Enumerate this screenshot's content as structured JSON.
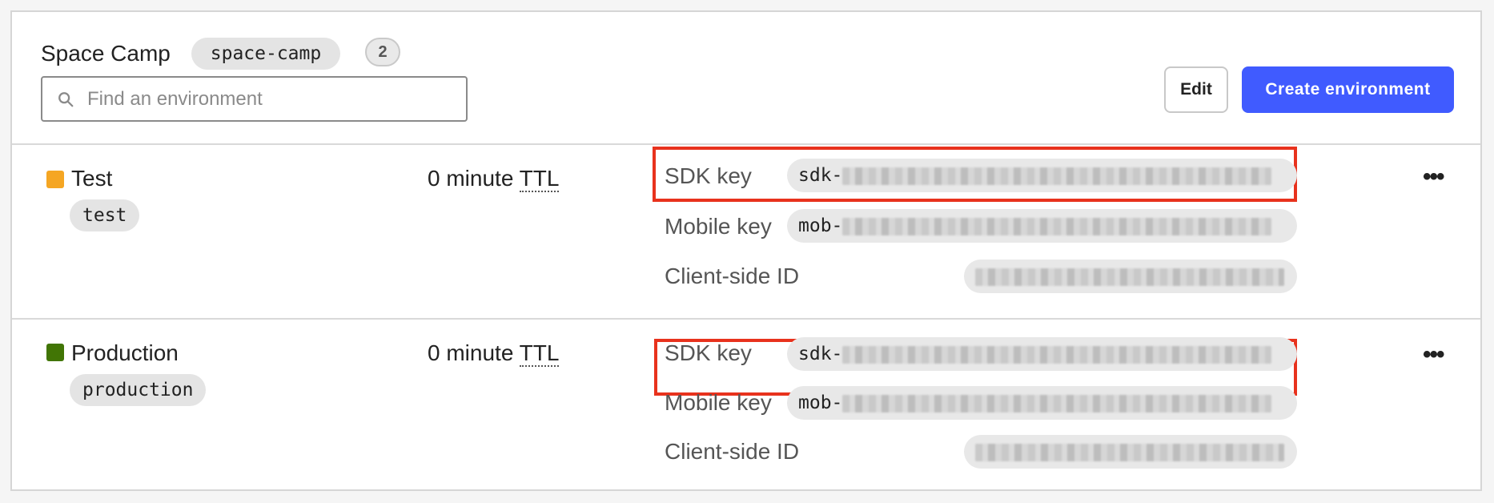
{
  "project": {
    "name": "Space Camp",
    "key": "space-camp",
    "environment_count": "2"
  },
  "search": {
    "placeholder": "Find an environment",
    "value": ""
  },
  "actions": {
    "edit_label": "Edit",
    "create_label": "Create environment"
  },
  "colors": {
    "accent": "#405bff",
    "highlight": "#e8321d",
    "test_env": "#f5a623",
    "production_env": "#417505"
  },
  "environments": [
    {
      "name": "Test",
      "key": "test",
      "ttl_value": "0 minute ",
      "ttl_abbr": "TTL",
      "sdk_label": "SDK key",
      "sdk_prefix": "sdk-",
      "mobile_label": "Mobile key",
      "mobile_prefix": "mob-",
      "client_label": "Client-side ID",
      "more_icon": "more-horizontal-icon"
    },
    {
      "name": "Production",
      "key": "production",
      "ttl_value": "0 minute ",
      "ttl_abbr": "TTL",
      "sdk_label": "SDK key",
      "sdk_prefix": "sdk-",
      "mobile_label": "Mobile key",
      "mobile_prefix": "mob-",
      "client_label": "Client-side ID",
      "more_icon": "more-horizontal-icon"
    }
  ]
}
